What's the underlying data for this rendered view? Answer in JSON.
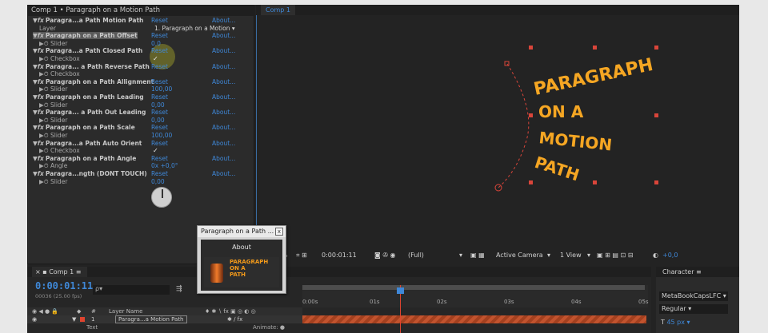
{
  "effect_controls": {
    "title": "Comp 1 • Paragraph on a Motion Path",
    "reset": "Reset",
    "about": "About...",
    "rows": [
      {
        "name": "Paragra...a Path Motion Path",
        "kind": "effect"
      },
      {
        "sub": "Layer",
        "dropdown": "1. Paragraph on a Motion ▾"
      },
      {
        "name": "Paragraph on a Path Offset",
        "kind": "effect",
        "highlight": true
      },
      {
        "sub": "Slider",
        "value": "0,0"
      },
      {
        "name": "Paragra...a Path Closed Path",
        "kind": "effect"
      },
      {
        "sub": "Checkbox",
        "check": "✓"
      },
      {
        "name": "Paragra... a Path Reverse Path",
        "kind": "effect"
      },
      {
        "sub": "Checkbox"
      },
      {
        "name": "Paragraph on a Path Allignment",
        "kind": "effect"
      },
      {
        "sub": "Slider",
        "value": "100,00"
      },
      {
        "name": "Paragraph on a Path Leading",
        "kind": "effect"
      },
      {
        "sub": "Slider",
        "value": "0,00"
      },
      {
        "name": "Paragra... a Path Out Leading",
        "kind": "effect"
      },
      {
        "sub": "Slider",
        "value": "0,00"
      },
      {
        "name": "Paragraph on a Path Scale",
        "kind": "effect"
      },
      {
        "sub": "Slider",
        "value": "100,00"
      },
      {
        "name": "Paragra...a Path Auto Orient",
        "kind": "effect"
      },
      {
        "sub": "Checkbox",
        "check": "✓"
      },
      {
        "name": "Paragraph on a Path Angle",
        "kind": "effect"
      },
      {
        "sub": "Angle",
        "value": "0x +0,0°"
      },
      {
        "name": "Paragra...ngth (DONT TOUCH)",
        "kind": "effect"
      },
      {
        "sub": "Slider",
        "value": "0,00"
      }
    ]
  },
  "comp_viewer": {
    "tab": "Comp 1",
    "path_text": [
      "PARAGRAPH",
      "ON A",
      "MOTION",
      "PATH"
    ],
    "text_color": "#f5a623",
    "zoom": "%",
    "timecode": "0:00:01:11",
    "resolution": "(Full)",
    "camera": "Active Camera",
    "view": "1 View",
    "exposure": "+0,0"
  },
  "timeline": {
    "tab": "Comp 1",
    "timecode": "0:00:01:11",
    "fps": "00036 (25.00 fps)",
    "search_placeholder": "ρ▾",
    "col_num": "#",
    "col_layer": "Layer Name",
    "layer_num": "1",
    "layer_name": "Paragra...a Motion Path",
    "sub_row": "Text",
    "animate": "Animate: ●",
    "ruler": [
      "0:00s",
      "01s",
      "02s",
      "03s",
      "04s",
      "05s"
    ]
  },
  "character": {
    "tab": "Character",
    "font": "MetaBookCapsLFC ▾",
    "style": "Regular ▾",
    "size": "45 px ▾"
  },
  "about_dialog": {
    "title": "Paragraph on a Path ...",
    "close": "x",
    "button": "About",
    "logo_text": [
      "PARAGRAPH",
      "ON A",
      "PATH"
    ]
  }
}
